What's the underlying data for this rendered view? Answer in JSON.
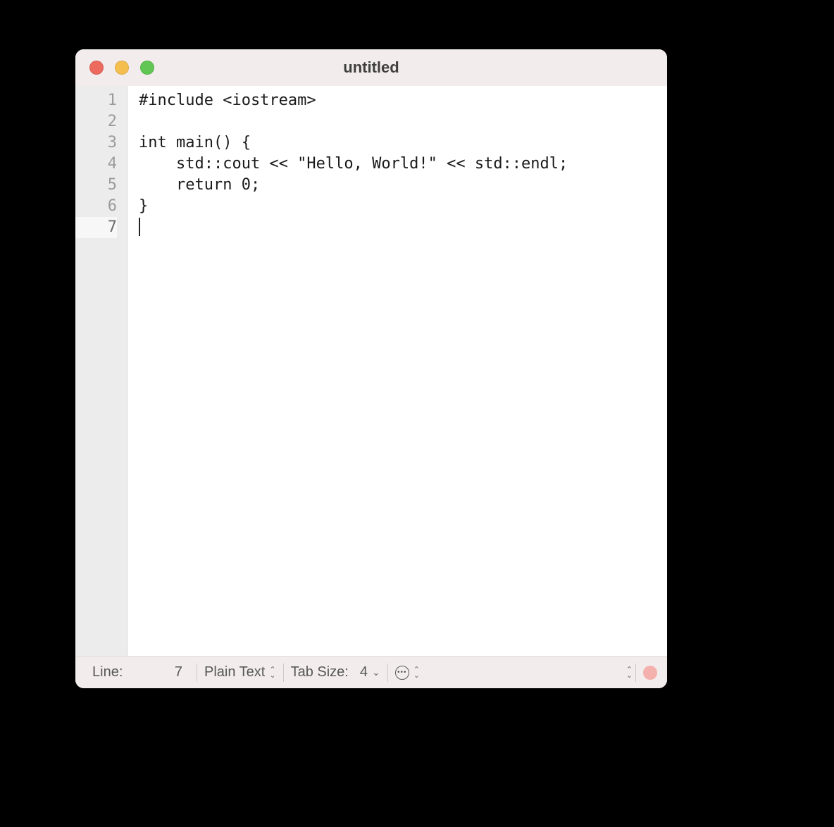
{
  "window": {
    "title": "untitled"
  },
  "editor": {
    "line_numbers": [
      "1",
      "2",
      "3",
      "4",
      "5",
      "6",
      "7"
    ],
    "current_line_index": 6,
    "lines": [
      "#include <iostream>",
      "",
      "int main() {",
      "    std::cout << \"Hello, World!\" << std::endl;",
      "    return 0;",
      "}",
      ""
    ]
  },
  "statusbar": {
    "line_label": "Line:",
    "line_value": "7",
    "syntax_label": "Plain Text",
    "tab_size_label": "Tab Size:",
    "tab_size_value": "4"
  }
}
